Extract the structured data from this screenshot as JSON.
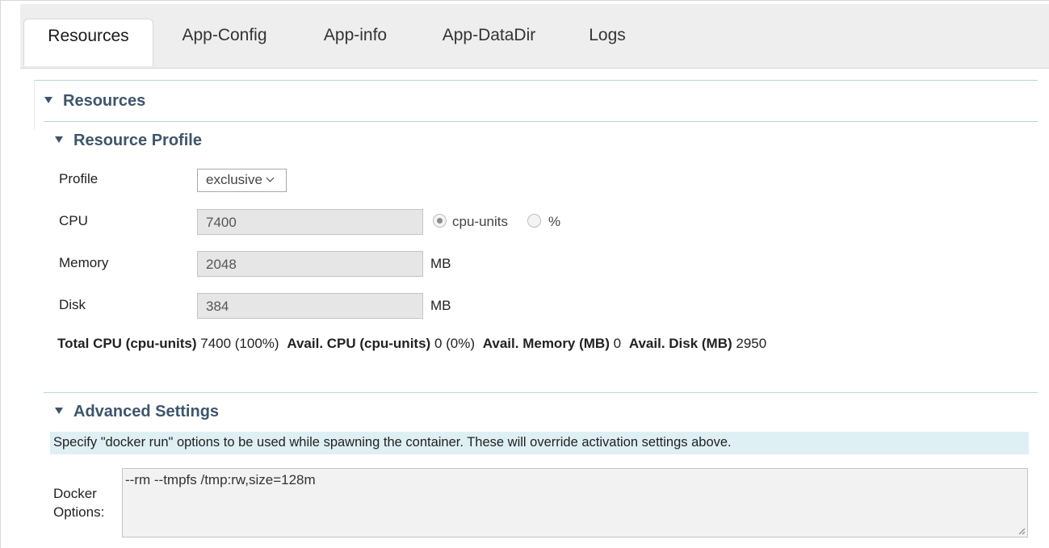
{
  "tabs": [
    "Resources",
    "App-Config",
    "App-info",
    "App-DataDir",
    "Logs"
  ],
  "resources_header": "Resources",
  "profile_section": {
    "title": "Resource Profile",
    "profile_label": "Profile",
    "profile_value": "exclusive",
    "cpu_label": "CPU",
    "cpu_value": "7400",
    "cpu_unit_options": [
      "cpu-units",
      "%"
    ],
    "cpu_unit_selected": "cpu-units",
    "memory_label": "Memory",
    "memory_value": "2048",
    "memory_unit": "MB",
    "disk_label": "Disk",
    "disk_value": "384",
    "disk_unit": "MB"
  },
  "totals": {
    "total_cpu_label": "Total CPU (cpu-units)",
    "total_cpu_value": "7400 (100%)",
    "avail_cpu_label": "Avail. CPU (cpu-units)",
    "avail_cpu_value": "0 (0%)",
    "avail_memory_label": "Avail. Memory (MB)",
    "avail_memory_value": "0",
    "avail_disk_label": "Avail. Disk (MB)",
    "avail_disk_value": "2950"
  },
  "advanced": {
    "title": "Advanced Settings",
    "note": "Specify \"docker run\" options to be used while spawning the container. These will override activation settings above.",
    "docker_label_line1": "Docker",
    "docker_label_line2": "Options:",
    "docker_value": "--rm --tmpfs /tmp:rw,size=128m"
  },
  "colors": {
    "header_text": "#3d556b",
    "section_rule": "#b6d5dc",
    "note_background": "#dff0f5",
    "tabbar_background": "#eeeeee"
  },
  "icons": {
    "section_toggle": "triangle-down-icon",
    "select_caret": "chevron-down-icon",
    "resize": "resize-grip-icon"
  }
}
